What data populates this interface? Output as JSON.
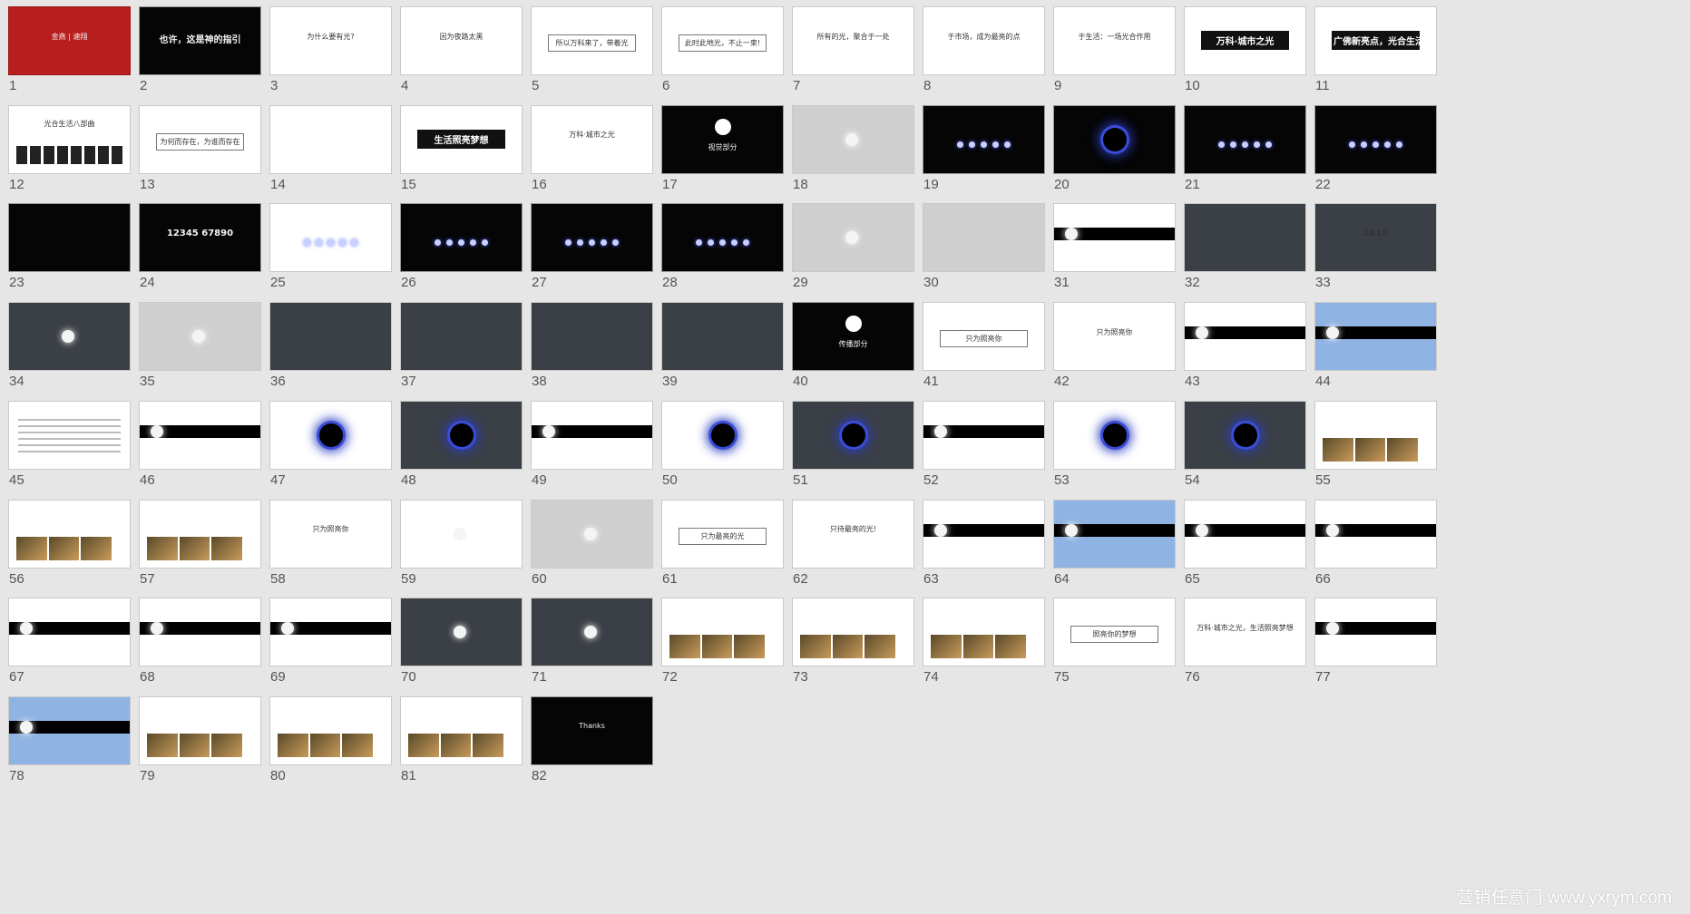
{
  "watermark": "营销任意门 www.yxrym.com",
  "slides": [
    {
      "n": "1",
      "style": "red",
      "title": "金燕 | 速翔",
      "kind": "title"
    },
    {
      "n": "2",
      "style": "dark",
      "title": "也许，这是神的指引",
      "kind": "big"
    },
    {
      "n": "3",
      "style": "white",
      "title": "为什么要有光?",
      "kind": "title"
    },
    {
      "n": "4",
      "style": "white",
      "title": "因为夜路太黑",
      "kind": "title"
    },
    {
      "n": "5",
      "style": "white",
      "title": "所以万科来了，带着光",
      "kind": "boxed"
    },
    {
      "n": "6",
      "style": "white",
      "title": "此时此地光，不止一束!",
      "kind": "boxed"
    },
    {
      "n": "7",
      "style": "white",
      "title": "所有的光，聚合于一处",
      "kind": "title"
    },
    {
      "n": "8",
      "style": "white",
      "title": "于市场，成为最亮的点",
      "kind": "title"
    },
    {
      "n": "9",
      "style": "white",
      "title": "于生活：一场光合作用",
      "kind": "title"
    },
    {
      "n": "10",
      "style": "white",
      "title": "万科·城市之光",
      "kind": "bar"
    },
    {
      "n": "11",
      "style": "white",
      "title": "广佛新亮点，光合生活区",
      "kind": "bar"
    },
    {
      "n": "12",
      "style": "white",
      "title": "光合生活八部曲",
      "kind": "blocks"
    },
    {
      "n": "13",
      "style": "white",
      "title": "为何而存在，为谁而存在",
      "kind": "boxed"
    },
    {
      "n": "14",
      "style": "white",
      "title": "",
      "kind": "title"
    },
    {
      "n": "15",
      "style": "white",
      "title": "生活照亮梦想",
      "kind": "bar"
    },
    {
      "n": "16",
      "style": "white",
      "title": "万科·城市之光",
      "kind": "title"
    },
    {
      "n": "17",
      "style": "dark",
      "title": "视觉部分",
      "kind": "badge"
    },
    {
      "n": "18",
      "style": "grey",
      "title": "",
      "kind": "moon"
    },
    {
      "n": "19",
      "style": "dark",
      "title": "",
      "kind": "orbs"
    },
    {
      "n": "20",
      "style": "dark",
      "title": "",
      "kind": "ring"
    },
    {
      "n": "21",
      "style": "dark",
      "title": "",
      "kind": "orbs"
    },
    {
      "n": "22",
      "style": "dark",
      "title": "",
      "kind": "orbs"
    },
    {
      "n": "23",
      "style": "dark",
      "title": "",
      "kind": "title"
    },
    {
      "n": "24",
      "style": "dark",
      "title": "12345 67890",
      "kind": "big"
    },
    {
      "n": "25",
      "style": "white",
      "title": "",
      "kind": "orbs"
    },
    {
      "n": "26",
      "style": "dark",
      "title": "",
      "kind": "orbs"
    },
    {
      "n": "27",
      "style": "dark",
      "title": "",
      "kind": "orbs"
    },
    {
      "n": "28",
      "style": "dark",
      "title": "",
      "kind": "orbs"
    },
    {
      "n": "29",
      "style": "grey",
      "title": "",
      "kind": "moon"
    },
    {
      "n": "30",
      "style": "grey",
      "title": "",
      "kind": "title"
    },
    {
      "n": "31",
      "style": "white",
      "title": "",
      "kind": "band"
    },
    {
      "n": "32",
      "style": "photo",
      "title": "",
      "kind": "title"
    },
    {
      "n": "33",
      "style": "photo",
      "title": "1419",
      "kind": "big"
    },
    {
      "n": "34",
      "style": "photo",
      "title": "",
      "kind": "moon"
    },
    {
      "n": "35",
      "style": "grey",
      "title": "",
      "kind": "moon"
    },
    {
      "n": "36",
      "style": "photo",
      "title": "",
      "kind": "title"
    },
    {
      "n": "37",
      "style": "photo",
      "title": "",
      "kind": "title"
    },
    {
      "n": "38",
      "style": "photo",
      "title": "",
      "kind": "title"
    },
    {
      "n": "39",
      "style": "photo",
      "title": "",
      "kind": "title"
    },
    {
      "n": "40",
      "style": "dark",
      "title": "传播部分",
      "kind": "badge"
    },
    {
      "n": "41",
      "style": "white",
      "title": "只为照亮你",
      "kind": "boxed"
    },
    {
      "n": "42",
      "style": "white",
      "title": "只为照亮你",
      "kind": "title"
    },
    {
      "n": "43",
      "style": "white",
      "title": "",
      "kind": "band"
    },
    {
      "n": "44",
      "style": "sky",
      "title": "",
      "kind": "band"
    },
    {
      "n": "45",
      "style": "white",
      "title": "",
      "kind": "lines"
    },
    {
      "n": "46",
      "style": "white",
      "title": "",
      "kind": "band"
    },
    {
      "n": "47",
      "style": "white",
      "title": "",
      "kind": "ring"
    },
    {
      "n": "48",
      "style": "photo",
      "title": "",
      "kind": "ring"
    },
    {
      "n": "49",
      "style": "white",
      "title": "",
      "kind": "band"
    },
    {
      "n": "50",
      "style": "white",
      "title": "",
      "kind": "ring"
    },
    {
      "n": "51",
      "style": "photo",
      "title": "",
      "kind": "ring"
    },
    {
      "n": "52",
      "style": "white",
      "title": "",
      "kind": "band"
    },
    {
      "n": "53",
      "style": "white",
      "title": "",
      "kind": "ring"
    },
    {
      "n": "54",
      "style": "photo",
      "title": "",
      "kind": "ring"
    },
    {
      "n": "55",
      "style": "white",
      "title": "",
      "kind": "pics"
    },
    {
      "n": "56",
      "style": "white",
      "title": "",
      "kind": "pics"
    },
    {
      "n": "57",
      "style": "white",
      "title": "",
      "kind": "pics"
    },
    {
      "n": "58",
      "style": "white",
      "title": "只为照亮你",
      "kind": "title"
    },
    {
      "n": "59",
      "style": "white",
      "title": "",
      "kind": "moon"
    },
    {
      "n": "60",
      "style": "grey",
      "title": "",
      "kind": "moon"
    },
    {
      "n": "61",
      "style": "white",
      "title": "只为最亮的光",
      "kind": "boxed"
    },
    {
      "n": "62",
      "style": "white",
      "title": "只待最亮的光!",
      "kind": "title"
    },
    {
      "n": "63",
      "style": "white",
      "title": "",
      "kind": "band"
    },
    {
      "n": "64",
      "style": "sky",
      "title": "",
      "kind": "band"
    },
    {
      "n": "65",
      "style": "white",
      "title": "",
      "kind": "band"
    },
    {
      "n": "66",
      "style": "white",
      "title": "",
      "kind": "band"
    },
    {
      "n": "67",
      "style": "white",
      "title": "",
      "kind": "band"
    },
    {
      "n": "68",
      "style": "white",
      "title": "",
      "kind": "band"
    },
    {
      "n": "69",
      "style": "white",
      "title": "",
      "kind": "band"
    },
    {
      "n": "70",
      "style": "photo",
      "title": "",
      "kind": "moon"
    },
    {
      "n": "71",
      "style": "photo",
      "title": "",
      "kind": "moon"
    },
    {
      "n": "72",
      "style": "white",
      "title": "",
      "kind": "pics"
    },
    {
      "n": "73",
      "style": "white",
      "title": "",
      "kind": "pics"
    },
    {
      "n": "74",
      "style": "white",
      "title": "",
      "kind": "pics"
    },
    {
      "n": "75",
      "style": "white",
      "title": "照亮你的梦想",
      "kind": "boxed"
    },
    {
      "n": "76",
      "style": "white",
      "title": "万科·城市之光，生活照亮梦想",
      "kind": "title"
    },
    {
      "n": "77",
      "style": "white",
      "title": "",
      "kind": "band"
    },
    {
      "n": "78",
      "style": "sky",
      "title": "",
      "kind": "band"
    },
    {
      "n": "79",
      "style": "white",
      "title": "",
      "kind": "pics"
    },
    {
      "n": "80",
      "style": "white",
      "title": "",
      "kind": "pics"
    },
    {
      "n": "81",
      "style": "white",
      "title": "",
      "kind": "pics"
    },
    {
      "n": "82",
      "style": "dark",
      "title": "Thanks",
      "kind": "title"
    }
  ]
}
